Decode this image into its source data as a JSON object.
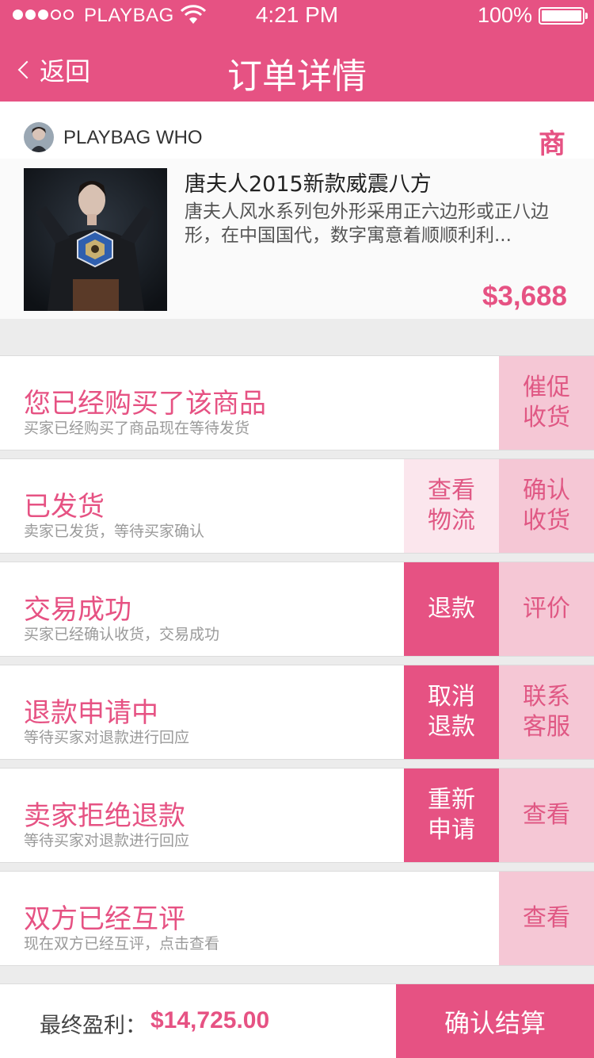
{
  "statusbar": {
    "carrier": "PLAYBAG",
    "time": "4:21 PM",
    "battery": "100%",
    "signal_dots_filled": 3,
    "signal_dots_total": 5
  },
  "nav": {
    "back_label": "返回",
    "title": "订单详情"
  },
  "product": {
    "seller_name": "PLAYBAG WHO",
    "shop_badge": "商",
    "title": "唐夫人2015新款威震八方",
    "description": "唐夫人风水系列包外形采用正六边形或正八边形，在中国国代，数字寓意着顺顺利利...",
    "price": "$3,688"
  },
  "orders": [
    {
      "title": "您已经购买了该商品",
      "subtitle": "买家已经购买了商品现在等待发货",
      "actions": [
        {
          "label": "催促\n收货",
          "style": "light"
        }
      ]
    },
    {
      "title": "已发货",
      "subtitle": "卖家已发货，等待买家确认",
      "actions": [
        {
          "label": "查看\n物流",
          "style": "lighter"
        },
        {
          "label": "确认\n收货",
          "style": "light"
        }
      ]
    },
    {
      "title": "交易成功",
      "subtitle": "买家已经确认收货，交易成功",
      "actions": [
        {
          "label": "退款",
          "style": "dark"
        },
        {
          "label": "评价",
          "style": "light"
        }
      ]
    },
    {
      "title": "退款申请中",
      "subtitle": "等待买家对退款进行回应",
      "actions": [
        {
          "label": "取消\n退款",
          "style": "dark"
        },
        {
          "label": "联系\n客服",
          "style": "light"
        }
      ]
    },
    {
      "title": "卖家拒绝退款",
      "subtitle": "等待买家对退款进行回应",
      "actions": [
        {
          "label": "重新\n申请",
          "style": "dark"
        },
        {
          "label": "查看",
          "style": "light"
        }
      ]
    },
    {
      "title": "双方已经互评",
      "subtitle": "现在双方已经互评，点击查看",
      "actions": [
        {
          "label": "查看",
          "style": "light"
        }
      ]
    }
  ],
  "footer": {
    "profit_label": "最终盈利：",
    "profit_value": "$14,725.00",
    "confirm_label": "确认结算"
  },
  "colors": {
    "accent": "#e65283",
    "action_light": "#f5c7d5",
    "action_lighter": "#fbe6ed"
  }
}
